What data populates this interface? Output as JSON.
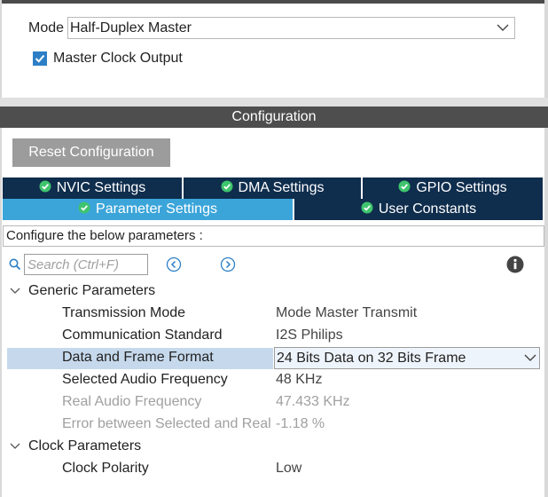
{
  "mode_section": {
    "mode_label": "Mode",
    "mode_value": "Half-Duplex Master",
    "master_clock_output_label": "Master Clock Output",
    "master_clock_output_checked": true
  },
  "configuration": {
    "header": "Configuration",
    "reset_button": "Reset Configuration",
    "tabs_row1": [
      {
        "label": "NVIC Settings",
        "active": false
      },
      {
        "label": "DMA Settings",
        "active": false
      },
      {
        "label": "GPIO Settings",
        "active": false
      }
    ],
    "tabs_row2": [
      {
        "label": "Parameter Settings",
        "active": true
      },
      {
        "label": "User Constants",
        "active": false
      }
    ],
    "configure_hint": "Configure the below parameters :",
    "search_placeholder": "Search (Ctrl+F)",
    "groups": [
      {
        "label": "Generic Parameters",
        "params": [
          {
            "name": "Transmission Mode",
            "value": "Mode Master Transmit",
            "enabled": true
          },
          {
            "name": "Communication Standard",
            "value": "I2S Philips",
            "enabled": true
          },
          {
            "name": "Data and Frame Format",
            "value": "24 Bits Data on 32 Bits Frame",
            "enabled": true,
            "selected": true
          },
          {
            "name": "Selected Audio Frequency",
            "value": "48 KHz",
            "enabled": true
          },
          {
            "name": "Real Audio Frequency",
            "value": "47.433 KHz",
            "enabled": false
          },
          {
            "name": "Error between Selected and Real",
            "value": "-1.18 %",
            "enabled": false
          }
        ]
      },
      {
        "label": "Clock Parameters",
        "params": [
          {
            "name": "Clock Polarity",
            "value": "Low",
            "enabled": true
          }
        ]
      }
    ]
  },
  "colors": {
    "tab_dark": "#0f2d4d",
    "tab_active": "#3ba5d9",
    "header_gray": "#4e4e4e",
    "checkbox_blue": "#2c7fc6",
    "row_highlight": "#c6d9ec"
  }
}
